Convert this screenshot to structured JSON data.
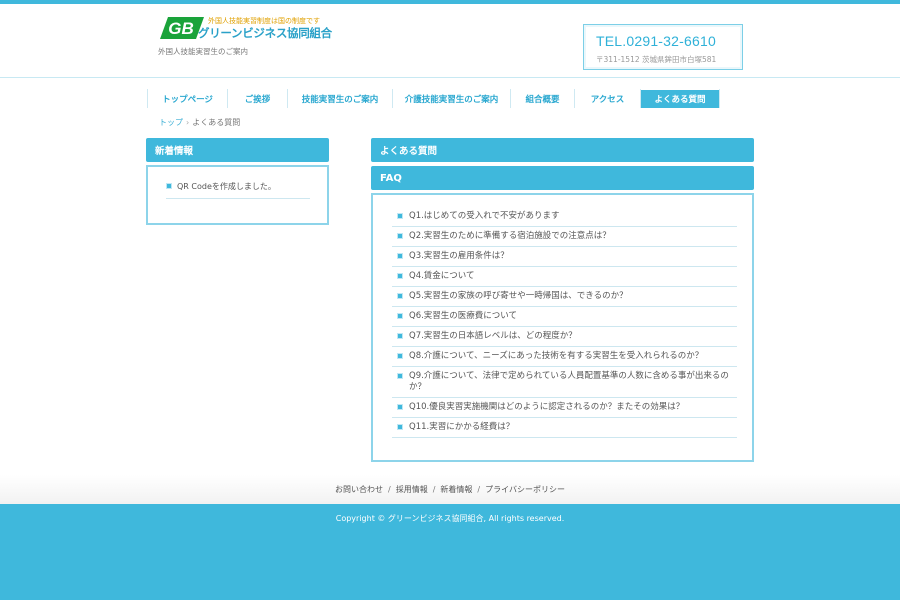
{
  "colors": {
    "accent": "#3fb8dc",
    "accent_light": "#8dd4ea",
    "logo_green": "#1aa33a",
    "logo_orange": "#e0a000"
  },
  "header": {
    "logo_mark": "GB",
    "logo_tagline": "外国人技能実習制度は国の制度です",
    "logo_name": "グリーンビジネス協同組合",
    "subtitle": "外国人技能実習生のご案内",
    "tel": "TEL.0291-32-6610",
    "address": "〒311-1512 茨城県鉾田市白塚581"
  },
  "nav": [
    {
      "label": "トップページ",
      "active": false
    },
    {
      "label": "ご挨拶",
      "active": false
    },
    {
      "label": "技能実習生のご案内",
      "active": false
    },
    {
      "label": "介護技能実習生のご案内",
      "active": false
    },
    {
      "label": "組合概要",
      "active": false
    },
    {
      "label": "アクセス",
      "active": false
    },
    {
      "label": "よくある質問",
      "active": true
    }
  ],
  "breadcrumb": {
    "home": "トップ",
    "separator": "›",
    "current": "よくある質問"
  },
  "sidebar": {
    "title": "新着情報",
    "items": [
      "QR Codeを作成しました。"
    ]
  },
  "main": {
    "title": "よくある質問",
    "section_title": "FAQ",
    "questions": [
      "Q1.はじめての受入れで不安があります",
      "Q2.実習生のために準備する宿泊施設での注意点は？",
      "Q3.実習生の雇用条件は？",
      "Q4.賃金について",
      "Q5.実習生の家族の呼び寄せや一時帰国は、できるのか？",
      "Q6.実習生の医療費について",
      "Q7.実習生の日本語レベルは、どの程度か？",
      "Q8.介護について、ニーズにあった技術を有する実習生を受入れられるのか？",
      "Q9.介護について、法律で定められている人員配置基準の人数に含める事が出来るのか？",
      "Q10.優良実習実施機関はどのように認定されるのか？またその効果は？",
      "Q11.実習にかかる経費は？"
    ]
  },
  "footer": {
    "links": [
      "お問い合わせ",
      "採用情報",
      "新着情報",
      "プライバシーポリシー"
    ],
    "separator": "/",
    "copyright": "Copyright © グリーンビジネス協同組合, All rights reserved."
  }
}
